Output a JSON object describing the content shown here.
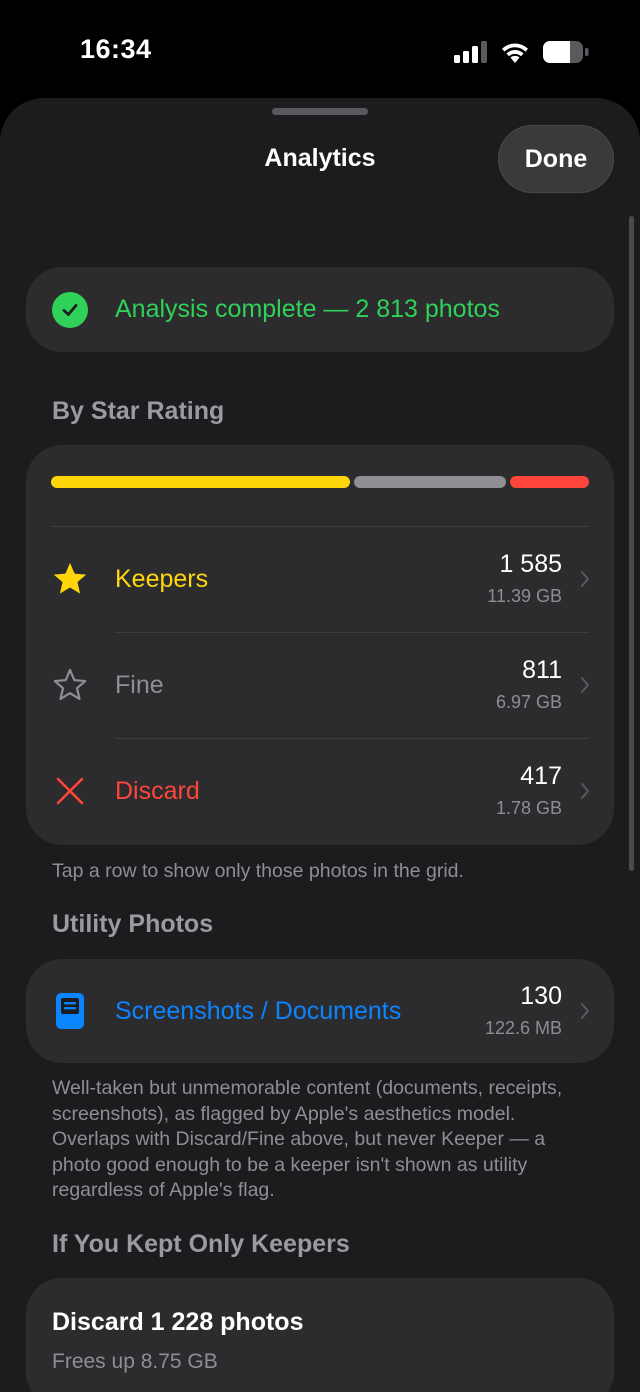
{
  "status_bar": {
    "time": "16:34"
  },
  "sheet": {
    "title": "Analytics",
    "done_label": "Done"
  },
  "analysis_status": {
    "text": "Analysis complete — 2 813 photos"
  },
  "star_rating": {
    "header": "By Star Rating",
    "distribution": [
      {
        "name": "keepers",
        "value": 1585,
        "color": "#ffd60a"
      },
      {
        "name": "fine",
        "value": 811,
        "color": "#8e8e93"
      },
      {
        "name": "discard",
        "value": 417,
        "color": "#ff453a"
      }
    ],
    "rows": [
      {
        "label": "Keepers",
        "count": "1 585",
        "size": "11.39 GB",
        "color": "#ffd60a",
        "icon": "star-filled-icon"
      },
      {
        "label": "Fine",
        "count": "811",
        "size": "6.97 GB",
        "color": "#8e8e93",
        "icon": "star-outline-icon"
      },
      {
        "label": "Discard",
        "count": "417",
        "size": "1.78 GB",
        "color": "#ff453a",
        "icon": "x-mark-icon"
      }
    ],
    "caption": "Tap a row to show only those photos in the grid."
  },
  "utility": {
    "header": "Utility Photos",
    "row": {
      "label": "Screenshots / Documents",
      "count": "130",
      "size": "122.6 MB",
      "color": "#0a84ff",
      "icon": "document-icon"
    },
    "caption": "Well-taken but unmemorable content (documents, receipts, screenshots), as flagged by Apple's aesthetics model. Overlaps with Discard/Fine above, but never Keeper — a photo good enough to be a keeper isn't shown as utility regardless of Apple's flag."
  },
  "keepers_only": {
    "header": "If You Kept Only Keepers",
    "title": "Discard 1 228 photos",
    "subtitle": "Frees up 8.75 GB"
  }
}
